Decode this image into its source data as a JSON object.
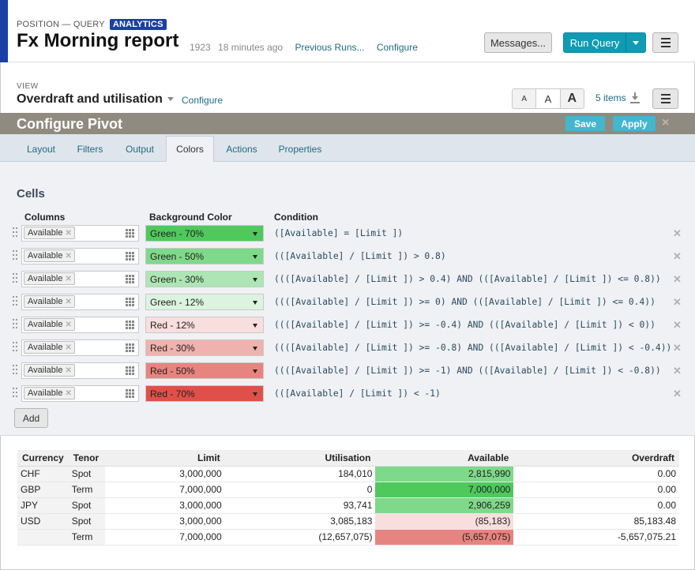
{
  "header": {
    "crumb": "POSITION — QUERY",
    "badge": "ANALYTICS",
    "title": "Fx Morning report",
    "run_id": "1923",
    "time_ago": "18 minutes ago",
    "previous_runs": "Previous Runs...",
    "configure": "Configure",
    "messages": "Messages...",
    "run_query": "Run Query"
  },
  "view": {
    "label": "VIEW",
    "name": "Overdraft and utilisation",
    "configure": "Configure",
    "font_small": "A",
    "font_medium": "A",
    "font_large": "A",
    "items": "5 items"
  },
  "pivot": {
    "title": "Configure Pivot",
    "save": "Save",
    "apply": "Apply",
    "close": "×"
  },
  "tabs": [
    "Layout",
    "Filters",
    "Output",
    "Colors",
    "Actions",
    "Properties"
  ],
  "active_tab": "Colors",
  "cells": {
    "heading": "Cells",
    "columns_header": "Columns",
    "bg_header": "Background Color",
    "cond_header": "Condition",
    "rules": [
      {
        "column": "Available",
        "color": "Green - 70%",
        "hex": "#4ec95c",
        "condition": "([Available] = [Limit ])"
      },
      {
        "column": "Available",
        "color": "Green - 50%",
        "hex": "#7ed98a",
        "condition": "(([Available] / [Limit ]) > 0.8)"
      },
      {
        "column": "Available",
        "color": "Green - 30%",
        "hex": "#ade6b4",
        "condition": "((([Available] / [Limit ]) > 0.4) AND (([Available] / [Limit ]) <= 0.8))"
      },
      {
        "column": "Available",
        "color": "Green - 12%",
        "hex": "#dcf4df",
        "condition": "((([Available] / [Limit ]) >= 0) AND (([Available] / [Limit ]) <= 0.4))"
      },
      {
        "column": "Available",
        "color": "Red - 12%",
        "hex": "#f8dedd",
        "condition": "((([Available] / [Limit ]) >= -0.4) AND (([Available] / [Limit ]) < 0))"
      },
      {
        "column": "Available",
        "color": "Red - 30%",
        "hex": "#f0b2ae",
        "condition": "((([Available] / [Limit ]) >= -0.8) AND (([Available] / [Limit ]) < -0.4))"
      },
      {
        "column": "Available",
        "color": "Red - 50%",
        "hex": "#e8847f",
        "condition": "((([Available] / [Limit ]) >= -1) AND (([Available] / [Limit ]) < -0.8))"
      },
      {
        "column": "Available",
        "color": "Red - 70%",
        "hex": "#df504a",
        "condition": "(([Available] / [Limit ]) < -1)"
      }
    ],
    "add": "Add"
  },
  "table": {
    "headers": [
      "Currency",
      "Tenor",
      "Limit",
      "Utilisation",
      "Available",
      "Overdraft"
    ],
    "rows": [
      {
        "currency": "CHF",
        "tenor": "Spot",
        "limit": "3,000,000",
        "utilisation": "184,010",
        "available": "2,815,990",
        "available_bg": "#7ed98a",
        "overdraft": "0.00",
        "neg": false
      },
      {
        "currency": "GBP",
        "tenor": "Term",
        "limit": "7,000,000",
        "utilisation": "0",
        "available": "7,000,000",
        "available_bg": "#4ec95c",
        "overdraft": "0.00",
        "neg": false
      },
      {
        "currency": "JPY",
        "tenor": "Spot",
        "limit": "3,000,000",
        "utilisation": "93,741",
        "available": "2,906,259",
        "available_bg": "#7ed98a",
        "overdraft": "0.00",
        "neg": false
      },
      {
        "currency": "USD",
        "tenor": "Spot",
        "limit": "3,000,000",
        "utilisation": "3,085,183",
        "available": "(85,183)",
        "available_bg": "#f8dedd",
        "overdraft": "85,183.48",
        "neg": false
      },
      {
        "currency": "",
        "tenor": "Term",
        "limit": "7,000,000",
        "utilisation": "(12,657,075)",
        "available": "(5,657,075)",
        "available_bg": "#e8847f",
        "overdraft": "-5,657,075.21",
        "neg": true
      }
    ]
  }
}
